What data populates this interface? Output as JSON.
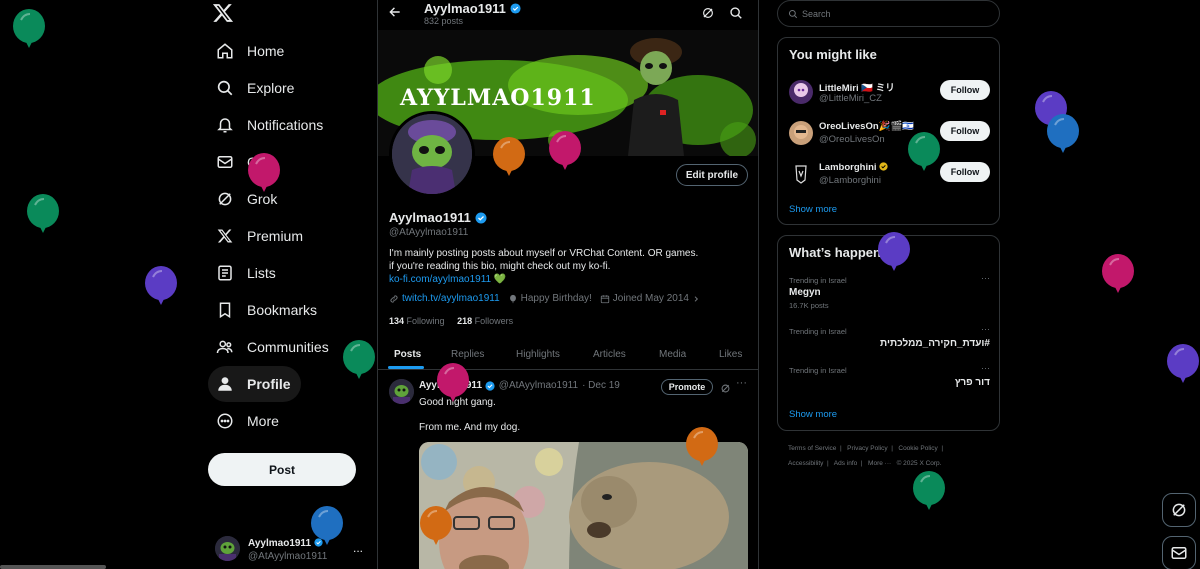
{
  "app": {
    "logo": "X"
  },
  "nav": {
    "items": [
      {
        "key": "home",
        "label": "Home",
        "icon": "home-icon"
      },
      {
        "key": "explore",
        "label": "Explore",
        "icon": "search-icon"
      },
      {
        "key": "notifications",
        "label": "Notifications",
        "icon": "bell-icon"
      },
      {
        "key": "chat",
        "label": "Chat",
        "icon": "mail-icon"
      },
      {
        "key": "grok",
        "label": "Grok",
        "icon": "grok-icon"
      },
      {
        "key": "premium",
        "label": "Premium",
        "icon": "x-logo-icon"
      },
      {
        "key": "lists",
        "label": "Lists",
        "icon": "list-icon"
      },
      {
        "key": "bookmarks",
        "label": "Bookmarks",
        "icon": "bookmark-icon"
      },
      {
        "key": "communities",
        "label": "Communities",
        "icon": "people-icon"
      },
      {
        "key": "profile",
        "label": "Profile",
        "icon": "person-icon",
        "active": true
      },
      {
        "key": "more",
        "label": "More",
        "icon": "more-circle-icon"
      }
    ],
    "post_label": "Post",
    "account": {
      "name": "Ayylmao1911",
      "handle": "@AtAyylmao1911",
      "more": "..."
    }
  },
  "profile": {
    "header_name": "Ayylmao1911",
    "post_count": "832 posts",
    "banner_text": "AYYLMAO1911",
    "edit_label": "Edit profile",
    "name": "Ayylmao1911",
    "handle": "@AtAyylmao1911",
    "bio_line1": "I'm mainly posting posts about myself or VRChat Content. OR games.",
    "bio_line2": "if you're reading this bio, might check out my ko-fi.",
    "bio_link": "ko-fi.com/ayylmao1911",
    "bio_heart": "💚",
    "website": "twitch.tv/ayylmao1911",
    "birthday": "Happy Birthday!",
    "joined": "Joined May 2014",
    "following_count": "134",
    "following_label": "Following",
    "followers_count": "218",
    "followers_label": "Followers",
    "tabs": [
      "Posts",
      "Replies",
      "Highlights",
      "Articles",
      "Media",
      "Likes"
    ],
    "active_tab": "Posts"
  },
  "tweet": {
    "name": "Ayylmao1911",
    "handle": "@AtAyylmao1911",
    "date": "· Dec 19",
    "promote_label": "Promote",
    "text1": "Good night gang.",
    "text2": "From me. And my dog.",
    "more": "···"
  },
  "search": {
    "placeholder": "Search"
  },
  "you_might_like": {
    "title": "You might like",
    "users": [
      {
        "name": "LittleMiri 🇨🇿 ミリ",
        "handle": "@LittleMiri_CZ",
        "follow": "Follow"
      },
      {
        "name": "OreoLivesOn🎉🎬🇮🇱",
        "handle": "@OreoLivesOn",
        "follow": "Follow"
      },
      {
        "name": "Lamborghini",
        "handle": "@Lamborghini",
        "follow": "Follow"
      }
    ],
    "show_more": "Show more"
  },
  "whats_happening": {
    "title": "What’s happening",
    "trends": [
      {
        "context": "Trending in Israel",
        "title": "Megyn",
        "count": "16.7K posts"
      },
      {
        "context": "Trending in Israel",
        "title": "#ועדת_חקירה_ממלכתית",
        "count": ""
      },
      {
        "context": "Trending in Israel",
        "title": "דור פרץ",
        "count": ""
      }
    ],
    "show_more": "Show more"
  },
  "footer": {
    "line1": [
      "Terms of Service",
      "|",
      "Privacy Policy",
      "|",
      "Cookie Policy",
      "|"
    ],
    "line2": [
      "Accessibility",
      "|",
      "Ads info",
      "|",
      "More ···",
      "© 2025 X Corp."
    ]
  },
  "colors": {
    "accent": "#1d9bf0",
    "verified_gold": "#e2b719",
    "balloon_green": "#0a8a5a",
    "balloon_pink": "#c2186b",
    "balloon_purple": "#5b3cc4",
    "balloon_orange": "#d26a14",
    "balloon_blue": "#1f6fc0"
  }
}
